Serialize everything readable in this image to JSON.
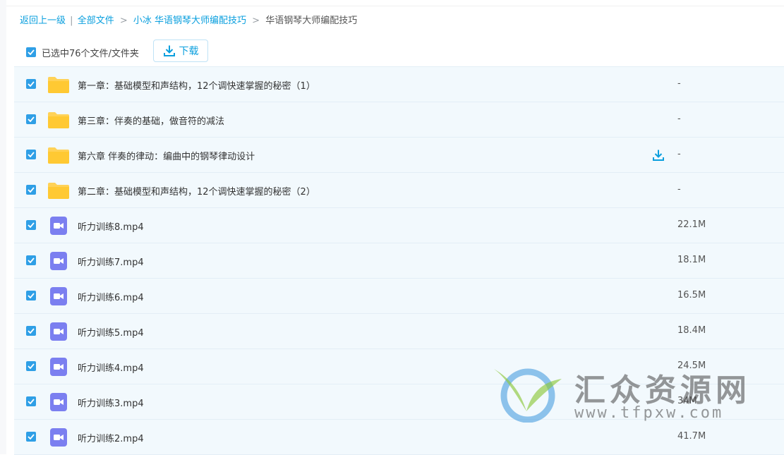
{
  "breadcrumb": {
    "back": "返回上一级",
    "all_files": "全部文件",
    "level1": "小冰 华语钢琴大师编配技巧",
    "current": "华语钢琴大师编配技巧",
    "bar_sep": "|",
    "arrow_sep": ">"
  },
  "toolbar": {
    "selected_label": "已选中76个文件/文件夹",
    "download_label": "下载"
  },
  "colors": {
    "accent": "#0a9fde",
    "checkbox": "#2f9fe6",
    "row_bg": "#f2f9fd",
    "folder": "#ffd257",
    "video": "#7b7ff0"
  },
  "files": [
    {
      "type": "folder-icon",
      "name": "第一章：基础模型和声结构，12个调快速掌握的秘密（1）",
      "size": "-"
    },
    {
      "type": "folder-icon",
      "name": "第三章：伴奏的基础，做音符的减法",
      "size": "-"
    },
    {
      "type": "folder-icon",
      "name": "第六章 伴奏的律动：编曲中的钢琴律动设计",
      "size": "-"
    },
    {
      "type": "folder-icon",
      "name": "第二章：基础模型和声结构，12个调快速掌握的秘密（2）",
      "size": "-"
    },
    {
      "type": "video-icon",
      "name": "听力训练8.mp4",
      "size": "22.1M"
    },
    {
      "type": "video-icon",
      "name": "听力训练7.mp4",
      "size": "18.1M"
    },
    {
      "type": "video-icon",
      "name": "听力训练6.mp4",
      "size": "16.5M"
    },
    {
      "type": "video-icon",
      "name": "听力训练5.mp4",
      "size": "18.4M"
    },
    {
      "type": "video-icon",
      "name": "听力训练4.mp4",
      "size": "24.5M"
    },
    {
      "type": "video-icon",
      "name": "听力训练3.mp4",
      "size": "34M"
    },
    {
      "type": "video-icon",
      "name": "听力训练2.mp4",
      "size": "41.7M"
    }
  ],
  "watermark": {
    "title": "汇众资源网",
    "url": "www.tfpxw.com"
  }
}
